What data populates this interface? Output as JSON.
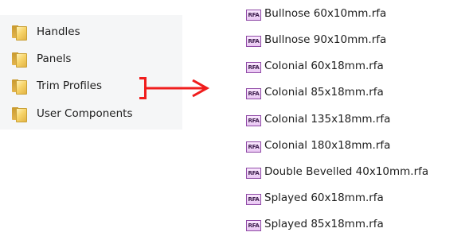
{
  "folders": [
    {
      "label": "Handles",
      "icon": "folder-icon"
    },
    {
      "label": "Panels",
      "icon": "folder-icon"
    },
    {
      "label": "Trim Profiles",
      "icon": "folder-icon"
    },
    {
      "label": "User Components",
      "icon": "folder-icon"
    }
  ],
  "annotation": {
    "color": "#f01d1d",
    "points_to": "Trim Profiles"
  },
  "files": [
    {
      "icon_text": "RFA",
      "label": "Bullnose 60x10mm.rfa"
    },
    {
      "icon_text": "RFA",
      "label": "Bullnose 90x10mm.rfa"
    },
    {
      "icon_text": "RFA",
      "label": "Colonial 60x18mm.rfa"
    },
    {
      "icon_text": "RFA",
      "label": "Colonial 85x18mm.rfa"
    },
    {
      "icon_text": "RFA",
      "label": "Colonial 135x18mm.rfa"
    },
    {
      "icon_text": "RFA",
      "label": "Colonial 180x18mm.rfa"
    },
    {
      "icon_text": "RFA",
      "label": "Double Bevelled 40x10mm.rfa"
    },
    {
      "icon_text": "RFA",
      "label": "Splayed 60x18mm.rfa"
    },
    {
      "icon_text": "RFA",
      "label": "Splayed 85x18mm.rfa"
    }
  ]
}
